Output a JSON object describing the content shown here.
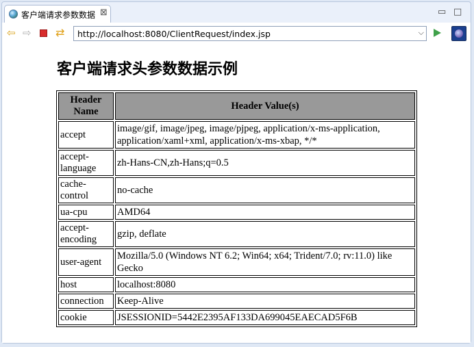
{
  "tab": {
    "title": "客户端请求参数数据",
    "close": "⊠"
  },
  "window": {
    "minimize": "▭",
    "maximize": "□"
  },
  "toolbar": {
    "url": "http://localhost:8080/ClientRequest/index.jsp",
    "dropdown": "⌵"
  },
  "page": {
    "title": "客户端请求头参数数据示例",
    "table": {
      "col_name": "Header Name",
      "col_value": "Header Value(s)",
      "rows": [
        {
          "name": "accept",
          "value": "image/gif, image/jpeg, image/pjpeg, application/x-ms-application, application/xaml+xml, application/x-ms-xbap, */*"
        },
        {
          "name": "accept-language",
          "value": "zh-Hans-CN,zh-Hans;q=0.5"
        },
        {
          "name": "cache-control",
          "value": "no-cache"
        },
        {
          "name": "ua-cpu",
          "value": "AMD64"
        },
        {
          "name": "accept-encoding",
          "value": "gzip, deflate"
        },
        {
          "name": "user-agent",
          "value": "Mozilla/5.0 (Windows NT 6.2; Win64; x64; Trident/7.0; rv:11.0) like Gecko"
        },
        {
          "name": "host",
          "value": "localhost:8080"
        },
        {
          "name": "connection",
          "value": "Keep-Alive"
        },
        {
          "name": "cookie",
          "value": "JSESSIONID=5442E2395AF133DA699045EAECAD5F6B"
        }
      ]
    }
  }
}
